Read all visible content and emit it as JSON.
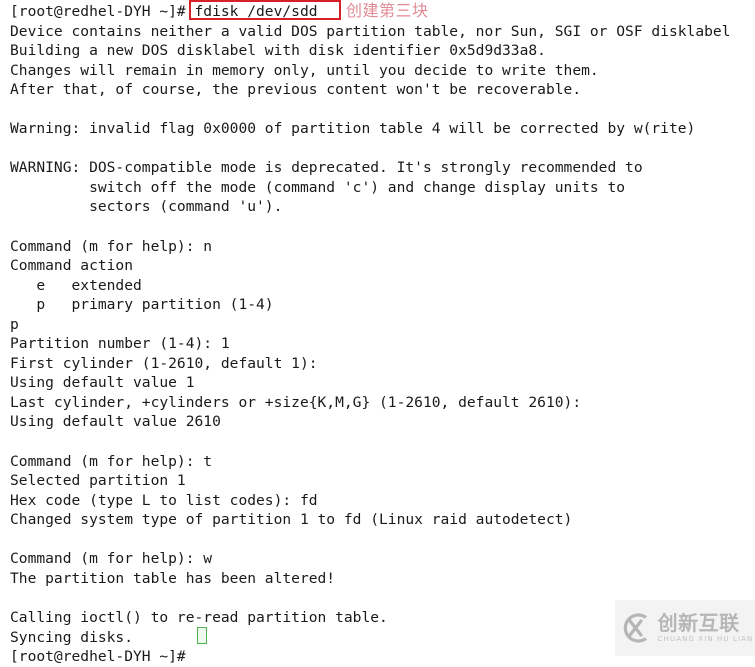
{
  "terminal": {
    "prompt": "[root@redhel-DYH ~]#",
    "typed_command": "fdisk /dev/sdd",
    "lines": [
      "[root@redhel-DYH ~]# fdisk /dev/sdd",
      "Device contains neither a valid DOS partition table, nor Sun, SGI or OSF disklabel",
      "Building a new DOS disklabel with disk identifier 0x5d9d33a8.",
      "Changes will remain in memory only, until you decide to write them.",
      "After that, of course, the previous content won't be recoverable.",
      "",
      "Warning: invalid flag 0x0000 of partition table 4 will be corrected by w(rite)",
      "",
      "WARNING: DOS-compatible mode is deprecated. It's strongly recommended to",
      "         switch off the mode (command 'c') and change display units to",
      "         sectors (command 'u').",
      "",
      "Command (m for help): n",
      "Command action",
      "   e   extended",
      "   p   primary partition (1-4)",
      "p",
      "Partition number (1-4): 1",
      "First cylinder (1-2610, default 1):",
      "Using default value 1",
      "Last cylinder, +cylinders or +size{K,M,G} (1-2610, default 2610):",
      "Using default value 2610",
      "",
      "Command (m for help): t",
      "Selected partition 1",
      "Hex code (type L to list codes): fd",
      "Changed system type of partition 1 to fd (Linux raid autodetect)",
      "",
      "Command (m for help): w",
      "The partition table has been altered!",
      "",
      "Calling ioctl() to re-read partition table.",
      "Syncing disks.",
      "[root@redhel-DYH ~]# "
    ],
    "disk_identifier": "0x5d9d33a8",
    "device": "/dev/sdd",
    "cylinder_range": "1-2610",
    "partition_number": "1",
    "hex_code": "fd",
    "partition_type_name": "Linux raid autodetect"
  },
  "annotation": {
    "text": "创建第三块",
    "color": "#e08b96",
    "box_color": "#d8202a"
  },
  "cursor": {
    "color": "#4fb24f"
  },
  "watermark": {
    "chinese": "创新互联",
    "pinyin": "CHUANG XIN HU LIAN",
    "logo_letters": "CX",
    "color": "#b6b6b6"
  }
}
